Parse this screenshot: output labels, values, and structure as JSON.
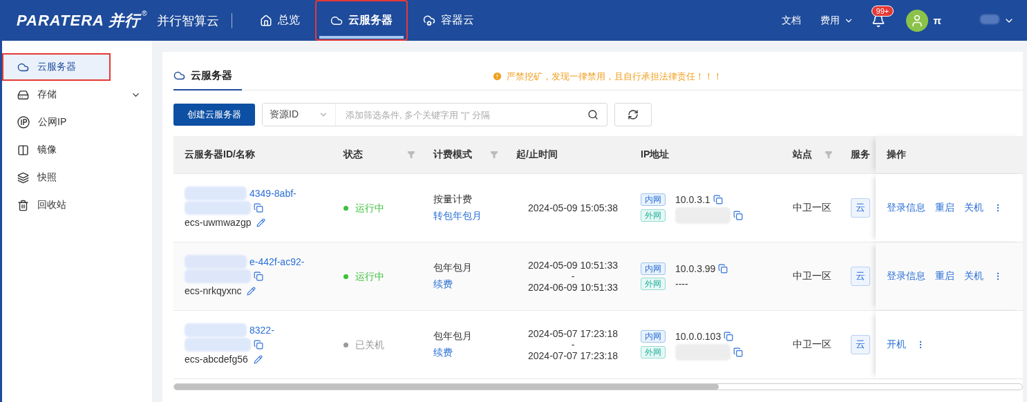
{
  "header": {
    "logo": "PARATERA 并行",
    "logo_mark": "®",
    "product": "并行智算云",
    "nav": [
      {
        "label": "总览",
        "selected": false,
        "annotated": false
      },
      {
        "label": "云服务器",
        "selected": true,
        "annotated": true
      },
      {
        "label": "容器云",
        "selected": false,
        "annotated": false
      }
    ],
    "links": [
      {
        "label": "文档",
        "dropdown": false
      },
      {
        "label": "费用",
        "dropdown": true
      }
    ],
    "notification_badge": "99+",
    "user_initial": "π"
  },
  "sidebar": {
    "items": [
      {
        "label": "云服务器",
        "selected": true,
        "annotated": true,
        "expandable": false
      },
      {
        "label": "存储",
        "selected": false,
        "annotated": false,
        "expandable": true
      },
      {
        "label": "公网IP",
        "selected": false,
        "annotated": false,
        "expandable": false
      },
      {
        "label": "镜像",
        "selected": false,
        "annotated": false,
        "expandable": false
      },
      {
        "label": "快照",
        "selected": false,
        "annotated": false,
        "expandable": false
      },
      {
        "label": "回收站",
        "selected": false,
        "annotated": false,
        "expandable": false
      }
    ]
  },
  "panel": {
    "tab": "云服务器",
    "warning": "严禁挖矿，发现一律禁用，且自行承担法律责任！！！",
    "create_button": "创建云服务器",
    "filter_select": "资源ID",
    "search": {
      "placeholder": "添加筛选条件, 多个关键字用 \"|\" 分隔"
    },
    "table": {
      "columns": [
        {
          "label": "云服务器ID/名称",
          "filter": false
        },
        {
          "label": "状态",
          "filter": true
        },
        {
          "label": "计费模式",
          "filter": true
        },
        {
          "label": "起/止时间",
          "filter": false
        },
        {
          "label": "IP地址",
          "filter": false
        },
        {
          "label": "站点",
          "filter": true
        },
        {
          "label": "服务"
        },
        {
          "label": "操作",
          "filter": false
        }
      ],
      "rows": [
        {
          "id_fragment": "4349-8abf-",
          "name": "ecs-uwmwazgp",
          "status": "运行中",
          "running": true,
          "billing": "按量计费",
          "billing_action": "转包年包月",
          "start": "2024-05-09 15:05:38",
          "internal_label": "内网",
          "internal_ip": "10.0.3.1",
          "external_label": "外网",
          "external_redacted": true,
          "site": "中卫一区",
          "service": "云",
          "actions": [
            "登录信息",
            "重启",
            "关机"
          ]
        },
        {
          "id_fragment": "e-442f-ac92-",
          "name": "ecs-nrkqyxnc",
          "status": "运行中",
          "running": true,
          "billing": "包年包月",
          "billing_action": "续费",
          "start": "2024-05-09 10:51:33",
          "separator": "-",
          "end": "2024-06-09 10:51:33",
          "internal_label": "内网",
          "internal_ip": "10.0.3.99",
          "external_label": "外网",
          "external": "----",
          "site": "中卫一区",
          "service": "云",
          "actions": [
            "登录信息",
            "重启",
            "关机"
          ]
        },
        {
          "id_fragment": "8322-",
          "name": "ecs-abcdefg56",
          "status": "已关机",
          "running": false,
          "billing": "包年包月",
          "billing_action": "续费",
          "start": "2024-05-07 17:23:18",
          "separator": "-",
          "end": "2024-07-07 17:23:18",
          "internal_label": "内网",
          "internal_ip": "10.0.0.103",
          "external_label": "外网",
          "external_redacted": true,
          "site": "中卫一区",
          "service": "云",
          "actions": [
            "开机"
          ]
        }
      ]
    }
  }
}
